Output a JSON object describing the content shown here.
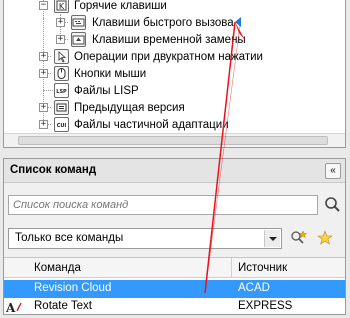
{
  "tree": {
    "items": [
      {
        "label": "Горячие клавиши",
        "expander": "−"
      },
      {
        "label": "Клавиши быстрого вызова",
        "expander": "+"
      },
      {
        "label": "Клавиши временной замены",
        "expander": "+"
      },
      {
        "label": "Операции при двукратном нажатии",
        "expander": "+"
      },
      {
        "label": "Кнопки мыши",
        "expander": "+"
      },
      {
        "label": "Файлы LISP",
        "expander": ""
      },
      {
        "label": "Предыдущая версия",
        "expander": "+"
      },
      {
        "label": "Файлы частичной адаптации",
        "expander": "+"
      }
    ],
    "icon_text": {
      "lisp": "LSP",
      "cui": "CUI"
    }
  },
  "command_list": {
    "title": "Список команд",
    "collapse_glyph": "«",
    "search_placeholder": "Список поиска команд",
    "filter_value": "Только все команды",
    "columns": {
      "command": "Команда",
      "source": "Источник"
    },
    "rows": [
      {
        "command": "Revision Cloud",
        "source": "ACAD",
        "selected": true
      },
      {
        "command": "Rotate Text",
        "source": "EXPRESS",
        "selected": false
      }
    ]
  },
  "colors": {
    "accent": "#3399ff",
    "marker": "#1e7ad6",
    "annotation_arrow": "#e8141c"
  }
}
